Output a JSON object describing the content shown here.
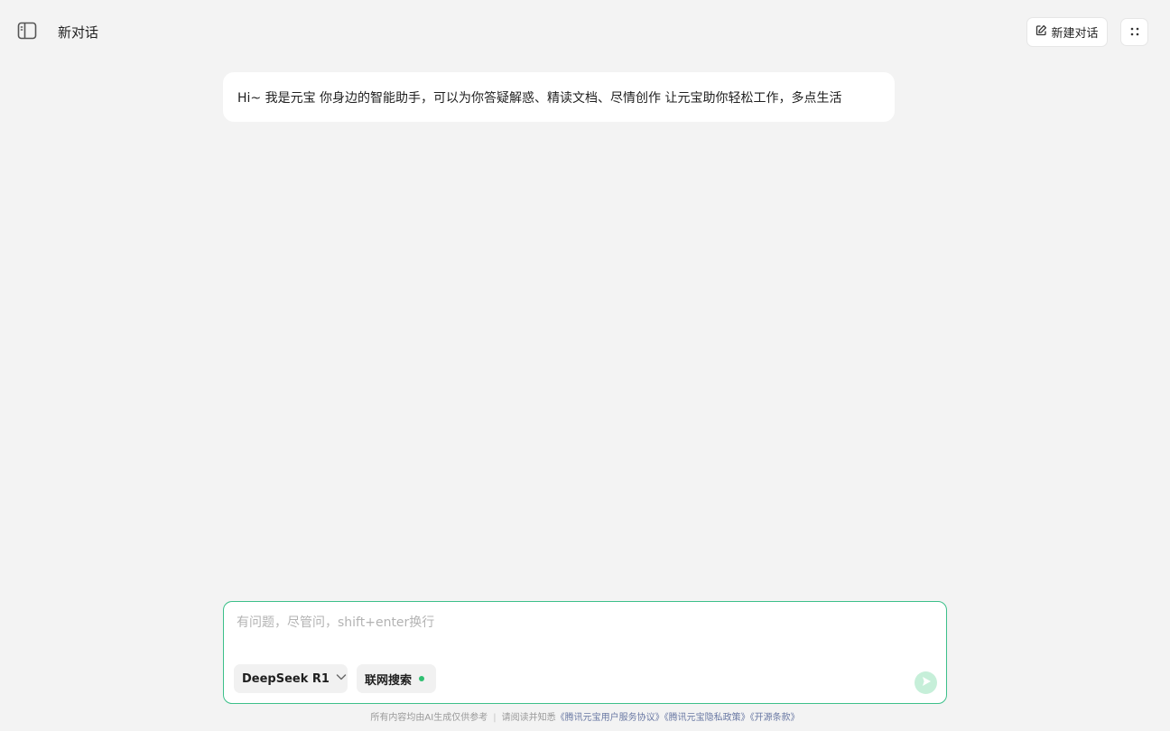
{
  "header": {
    "title": "新对话",
    "new_chat_label": "新建对话",
    "icons": {
      "sidebar_toggle": "sidebar-panel-icon",
      "new_chat": "edit-icon",
      "more": "dots-grid-icon"
    }
  },
  "greeting": {
    "text": "Hi~ 我是元宝 你身边的智能助手，可以为你答疑解惑、精读文档、尽情创作 让元宝助你轻松工作，多点生活"
  },
  "composer": {
    "placeholder": "有问题，尽管问，shift+enter换行",
    "value": "",
    "model_label": "DeepSeek R1",
    "search_label": "联网搜索",
    "search_enabled": true,
    "icons": {
      "model_dropdown": "chevron-down-icon",
      "send": "send-icon"
    }
  },
  "footer": {
    "disclaimer": "所有内容均由AI生成仅供参考",
    "separator": "|",
    "notice": "请阅读并知悉",
    "links": [
      "《腾讯元宝用户服务协议》",
      "《腾讯元宝隐私政策》",
      "《开源条款》"
    ]
  },
  "colors": {
    "background": "#f3f3f3",
    "accent": "#3cc08a",
    "send_disabled": "#c6efd9",
    "search_dot": "#2fbf71",
    "link": "#6a79a4"
  }
}
